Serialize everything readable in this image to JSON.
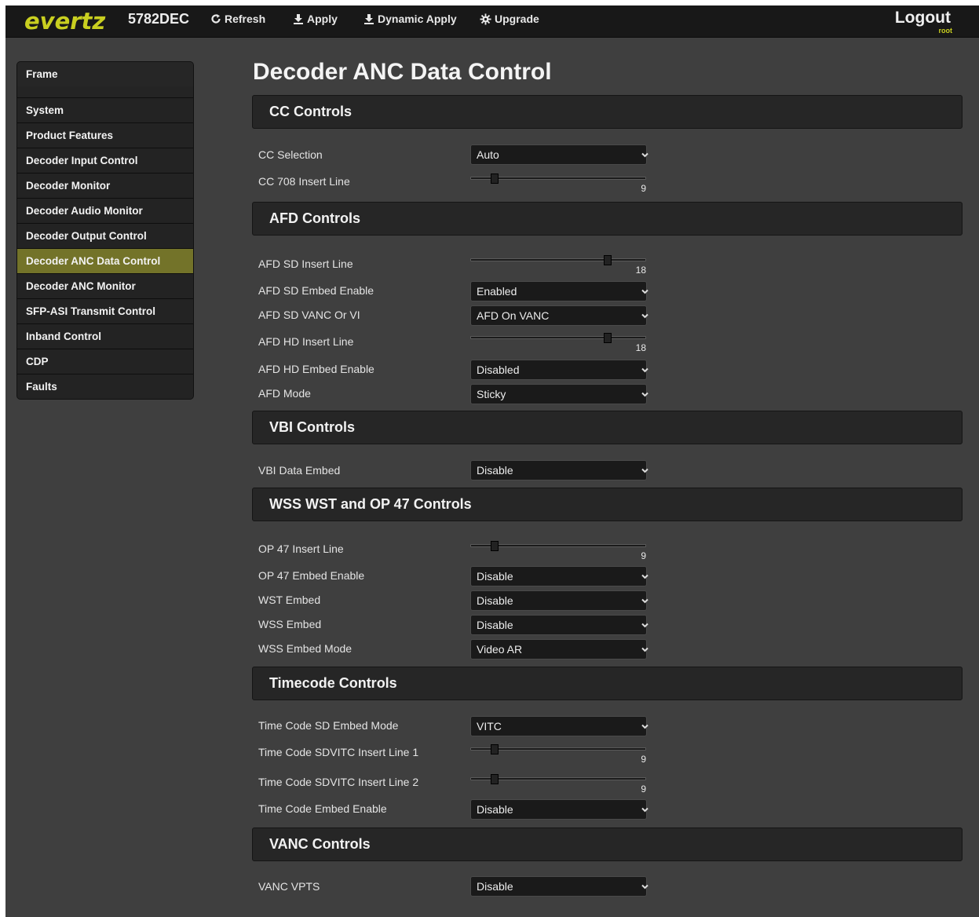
{
  "header": {
    "logo": "evertz",
    "model": "5782DEC",
    "refresh": "Refresh",
    "apply": "Apply",
    "dynamic_apply": "Dynamic Apply",
    "upgrade": "Upgrade",
    "logout": "Logout",
    "user": "root",
    "accent_color": "#c9cf20"
  },
  "sidebar": {
    "items": [
      {
        "label": "Frame"
      },
      {
        "label": "System"
      },
      {
        "label": "Product Features"
      },
      {
        "label": "Decoder Input Control"
      },
      {
        "label": "Decoder Monitor"
      },
      {
        "label": "Decoder Audio Monitor"
      },
      {
        "label": "Decoder Output Control"
      },
      {
        "label": "Decoder ANC Data Control"
      },
      {
        "label": "Decoder ANC Monitor"
      },
      {
        "label": "SFP-ASI Transmit Control"
      },
      {
        "label": "Inband Control"
      },
      {
        "label": "CDP"
      },
      {
        "label": "Faults"
      }
    ],
    "active": "Decoder ANC Data Control",
    "active_color": "#737329"
  },
  "page": {
    "title": "Decoder ANC Data Control"
  },
  "cc": {
    "title": "CC Controls",
    "selection_label": "CC Selection",
    "selection_value": "Auto",
    "insert_line_label": "CC 708 Insert Line",
    "insert_line_value": "9"
  },
  "afd": {
    "title": "AFD Controls",
    "sd_insert_line_label": "AFD SD Insert Line",
    "sd_insert_line_value": "18",
    "sd_embed_enable_label": "AFD SD Embed Enable",
    "sd_embed_enable_value": "Enabled",
    "sd_vanc_or_vi_label": "AFD SD VANC Or VI",
    "sd_vanc_or_vi_value": "AFD On VANC",
    "hd_insert_line_label": "AFD HD Insert Line",
    "hd_insert_line_value": "18",
    "hd_embed_enable_label": "AFD HD Embed Enable",
    "hd_embed_enable_value": "Disabled",
    "mode_label": "AFD Mode",
    "mode_value": "Sticky"
  },
  "vbi": {
    "title": "VBI Controls",
    "data_embed_label": "VBI Data Embed",
    "data_embed_value": "Disable"
  },
  "wss": {
    "title": "WSS WST and OP 47 Controls",
    "op47_insert_line_label": "OP 47 Insert Line",
    "op47_insert_line_value": "9",
    "op47_embed_enable_label": "OP 47 Embed Enable",
    "op47_embed_enable_value": "Disable",
    "wst_embed_label": "WST Embed",
    "wst_embed_value": "Disable",
    "wss_embed_label": "WSS Embed",
    "wss_embed_value": "Disable",
    "wss_embed_mode_label": "WSS Embed Mode",
    "wss_embed_mode_value": "Video AR"
  },
  "timecode": {
    "title": "Timecode Controls",
    "sd_embed_mode_label": "Time Code SD Embed Mode",
    "sd_embed_mode_value": "VITC",
    "sdvitc_line1_label": "Time Code SDVITC Insert Line 1",
    "sdvitc_line1_value": "9",
    "sdvitc_line2_label": "Time Code SDVITC Insert Line 2",
    "sdvitc_line2_value": "9",
    "embed_enable_label": "Time Code Embed Enable",
    "embed_enable_value": "Disable"
  },
  "vanc": {
    "title": "VANC Controls",
    "vpts_label": "VANC VPTS",
    "vpts_value": "Disable"
  }
}
